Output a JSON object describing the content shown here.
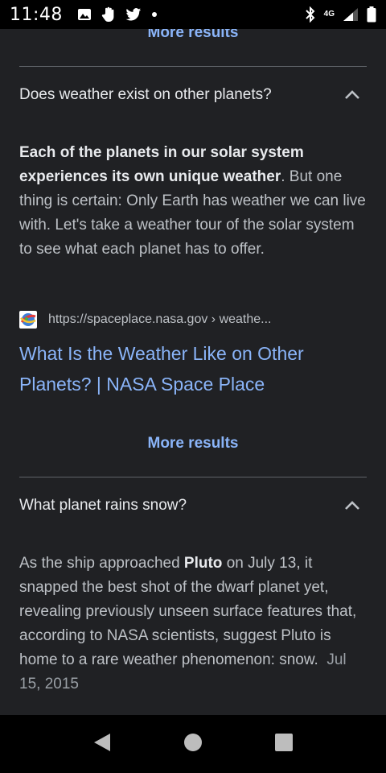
{
  "status_bar": {
    "time": "11:48",
    "network_label": "4G",
    "icons": [
      "image-icon",
      "hand-icon",
      "twitter-icon",
      "dot-icon",
      "bluetooth-icon",
      "signal-icon",
      "battery-icon"
    ]
  },
  "results": {
    "more_results_top": "More results",
    "q1": {
      "question": "Does weather exist on other planets?",
      "answer_bold": "Each of the planets in our solar system experiences its own unique weather",
      "answer_rest": ". But one thing is certain: Only Earth has weather we can live with. Let's take a weather tour of the solar system to see what each planet has to offer.",
      "source_url": "https://spaceplace.nasa.gov › weathe...",
      "title": "What Is the Weather Like on Other Planets? | NASA Space Place"
    },
    "more_results_bottom": "More results",
    "q2": {
      "question": "What planet rains snow?",
      "answer_a": "As the ship approached ",
      "answer_bold": "Pluto",
      "answer_b": " on July 13, it snapped the best shot of the dwarf planet yet, revealing previously unseen surface features that, according to NASA scientists, suggest Pluto is home to a rare weather phenomenon: snow.",
      "date": "Jul 15, 2015"
    }
  },
  "colors": {
    "background": "#202124",
    "link": "#8ab4f8",
    "text": "#bdc1c6",
    "divider": "#5f6368"
  }
}
